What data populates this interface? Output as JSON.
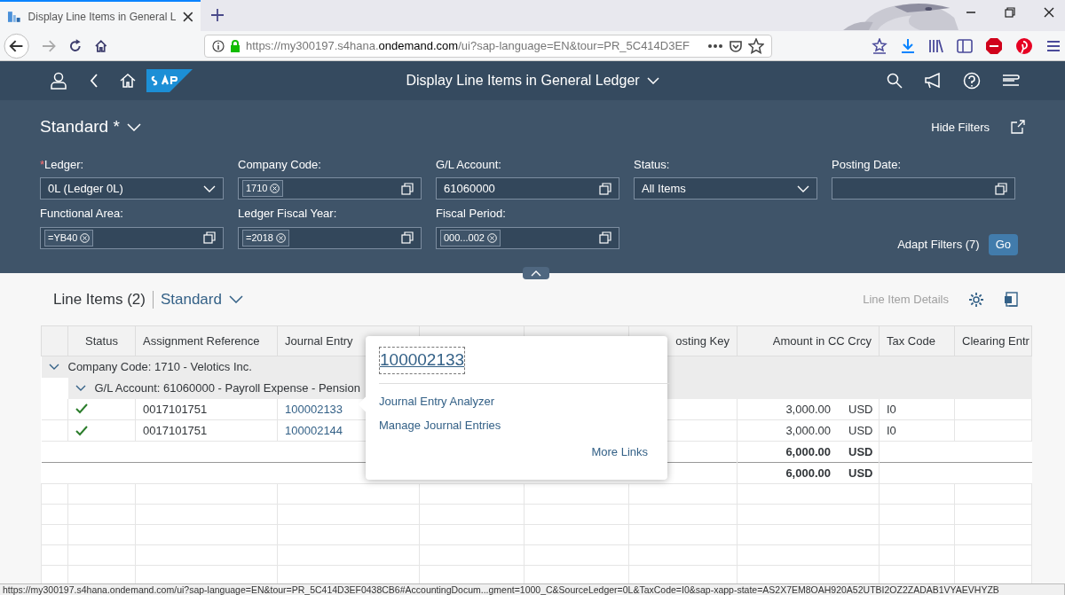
{
  "browser": {
    "tab": {
      "title": "Display Line Items in General L"
    },
    "url": {
      "prefix": "https://my300197.s4hana.",
      "domain": "ondemand.com",
      "rest": "/ui?sap-language=EN&tour=PR_5C414D3EF"
    }
  },
  "shell": {
    "title": "Display Line Items in General Ledger"
  },
  "filter_bar": {
    "variant": "Standard *",
    "hide_filters": "Hide Filters",
    "fields": [
      {
        "label": "Ledger:",
        "required_mark": "*",
        "kind": "select",
        "value": "0L (Ledger 0L)"
      },
      {
        "label": "Company Code:",
        "kind": "tokens",
        "tokens": [
          "1710"
        ]
      },
      {
        "label": "G/L Account:",
        "kind": "value_help",
        "value": "61060000"
      },
      {
        "label": "Status:",
        "kind": "select",
        "value": "All Items"
      },
      {
        "label": "Posting Date:",
        "kind": "value_help"
      },
      {
        "label": "Functional Area:",
        "kind": "tokens",
        "tokens": [
          "=YB40"
        ]
      },
      {
        "label": "Ledger Fiscal Year:",
        "kind": "tokens",
        "tokens": [
          "=2018"
        ]
      },
      {
        "label": "Fiscal Period:",
        "kind": "tokens",
        "tokens": [
          "000...002"
        ]
      }
    ],
    "adapt_filters": "Adapt Filters (7)",
    "go": "Go"
  },
  "table": {
    "title": "Line Items (2)",
    "variant": "Standard",
    "details_button": {
      "label": "Line Item Details",
      "disabled": true
    },
    "columns": [
      "Status",
      "Assignment Reference",
      "Journal Entry",
      "",
      "",
      "osting Key",
      "Amount in CC Crcy",
      "Tax Code",
      "Clearing Entr"
    ],
    "rows": [
      {
        "kind": "group",
        "text": "Company Code: 1710 - Velotics Inc.",
        "expanded": true
      },
      {
        "kind": "subgroup",
        "text": "G/L Account: 61060000 - Payroll Expense - Pension",
        "expanded": true
      },
      {
        "kind": "item",
        "status": {
          "kind": "success"
        },
        "assignment": "0017101751",
        "journal_entry": "100002133",
        "amount": "3,000.00",
        "currency": "USD",
        "tax_code": "I0"
      },
      {
        "kind": "item",
        "status": {
          "kind": "success"
        },
        "assignment": "0017101751",
        "journal_entry": "100002144",
        "amount": "3,000.00",
        "currency": "USD",
        "tax_code": "I0"
      },
      {
        "kind": "subtotal",
        "amount": "6,000.00",
        "currency": "USD"
      },
      {
        "kind": "total",
        "amount": "6,000.00",
        "currency": "USD"
      }
    ]
  },
  "popover": {
    "title": "100002133",
    "links": [
      "Journal Entry Analyzer",
      "Manage Journal Entries"
    ],
    "more_links": "More Links"
  },
  "status_bar": {
    "text": "https://my300197.s4hana.ondemand.com/ui?sap-language=EN&tour=PR_5C414D3EF0438CB6#AccountingDocum...gment=1000_C&SourceLedger=0L&TaxCode=I0&sap-xapp-state=AS2X7EM8OAH920A52UTBI2OZ2ZADAB1VYAEVHYZB"
  }
}
